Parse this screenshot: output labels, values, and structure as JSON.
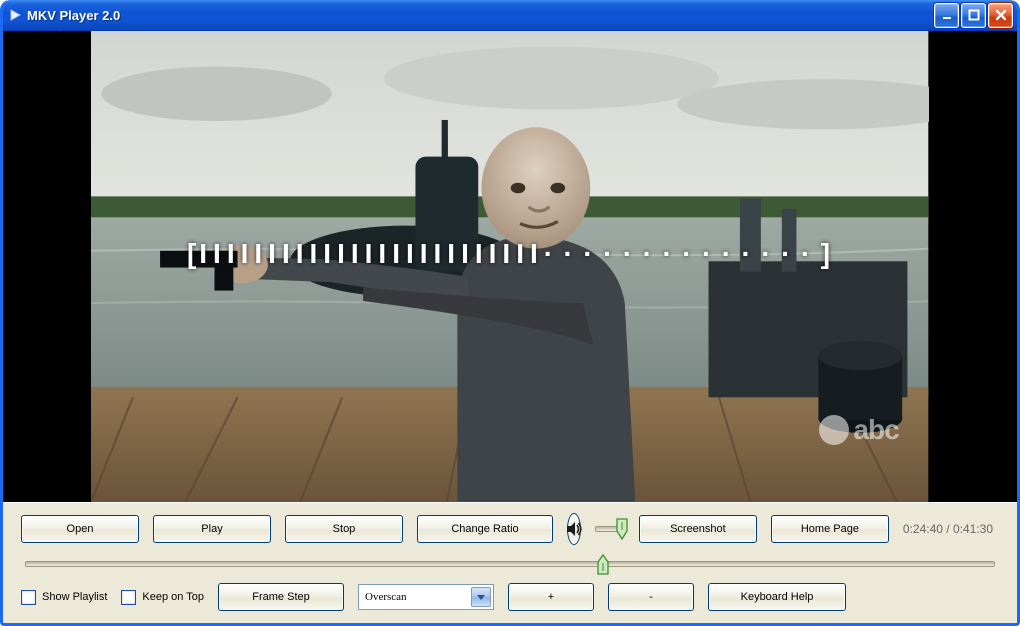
{
  "window": {
    "title": "MKV Player 2.0"
  },
  "playback": {
    "current_time": "0:24:40",
    "total_time": "0:41:30",
    "seek_fraction": 0.595,
    "volume_fraction": 0.9,
    "osd_bars_filled": 25,
    "osd_bars_total": 39
  },
  "buttons": {
    "open": "Open",
    "play": "Play",
    "stop": "Stop",
    "change_ratio": "Change Ratio",
    "screenshot": "Screenshot",
    "home_page": "Home Page",
    "frame_step": "Frame Step",
    "zoom_in": "+",
    "zoom_out": "-",
    "keyboard_help": "Keyboard Help"
  },
  "checkboxes": {
    "show_playlist": {
      "label": "Show Playlist",
      "checked": false
    },
    "keep_on_top": {
      "label": "Keep on Top",
      "checked": false
    }
  },
  "overscan": {
    "selected": "Overscan"
  },
  "watermark": {
    "text": "abc"
  },
  "icons": {
    "app": "play-triangle-icon",
    "minimize": "minimize-icon",
    "maximize": "maximize-icon",
    "close": "close-icon",
    "speaker": "speaker-icon",
    "dropdown": "chevron-down-icon"
  }
}
